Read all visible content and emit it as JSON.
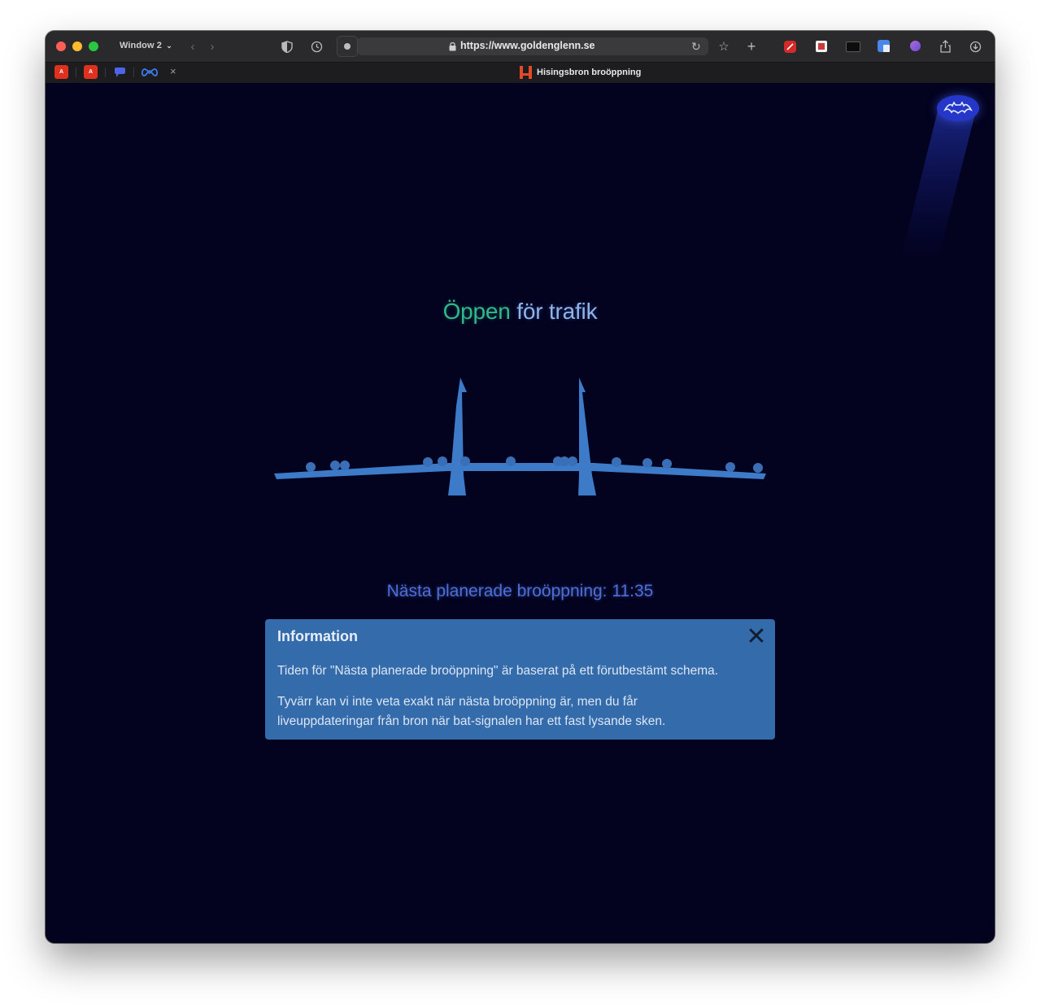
{
  "browser": {
    "window_label": "Window 2",
    "url": "https://www.goldenglenn.se",
    "active_tab_title": "Hisingsbron broöppning",
    "pinned_tabs": [
      {
        "name": "acrobat-tab-1",
        "label": "A"
      },
      {
        "name": "acrobat-tab-2",
        "label": "A"
      },
      {
        "name": "blue-chat-tab",
        "label": ""
      },
      {
        "name": "meta-tab",
        "label": ""
      }
    ],
    "icons": [
      "shield-icon",
      "history-icon",
      "reader-icon",
      "lock-icon",
      "reload-icon",
      "star-icon",
      "plus-icon",
      "extension-icon",
      "share-icon",
      "download-icon"
    ]
  },
  "page": {
    "status_word": "Öppen",
    "status_rest": " för trafik",
    "status_color": "#2fb88a",
    "next_opening_label": "Nästa planerade broöppning: 11:35",
    "signal_icon": "bat-signal-icon"
  },
  "info": {
    "title": "Information",
    "close_icon": "close-icon",
    "close_glyph": "✕",
    "paragraph_1": "Tiden för \"Nästa planerade broöppning\" är baserat på ett förutbestämt schema.",
    "paragraph_2_line_1": "Tyvärr kan vi inte veta exakt när nästa broöppning är, men du får",
    "paragraph_2_line_2": "liveuppdateringar från bron när bat-signalen har ett fast lysande sken."
  }
}
